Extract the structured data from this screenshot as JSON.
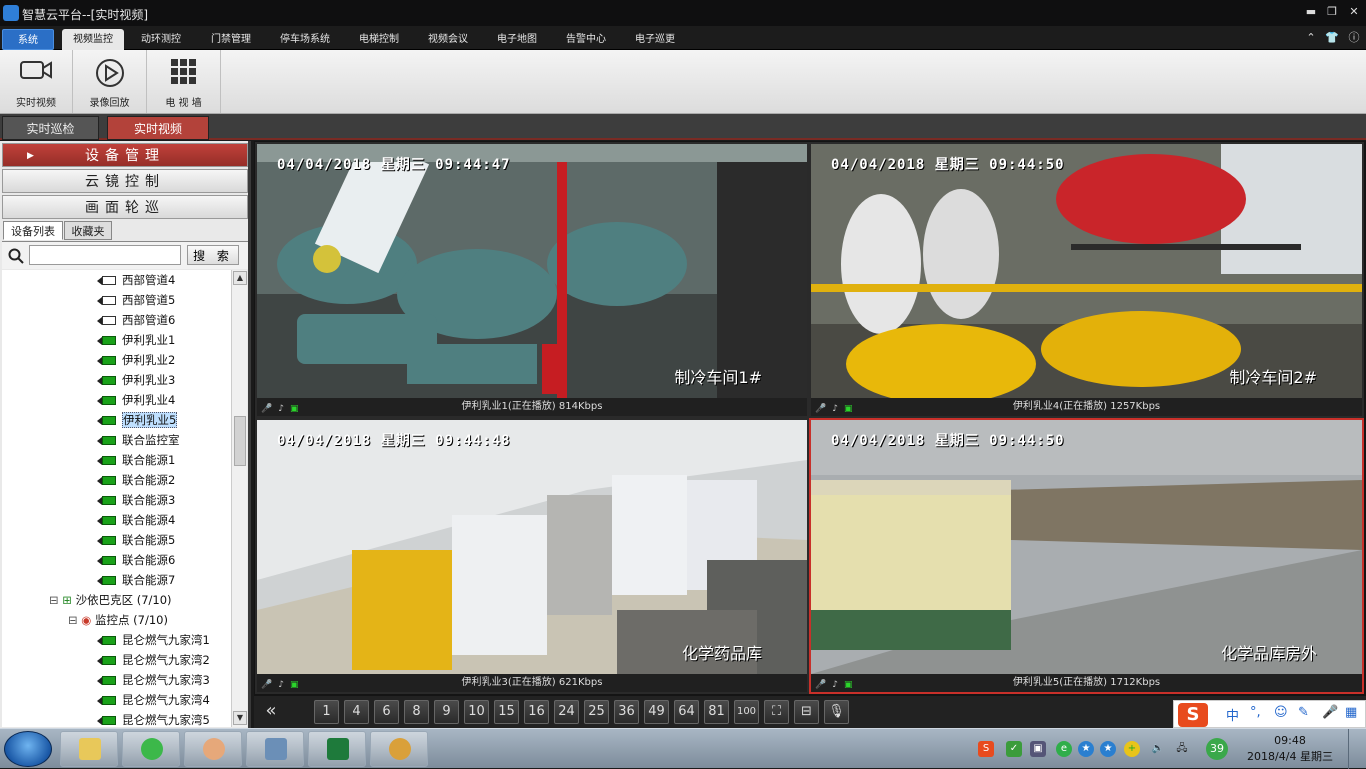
{
  "window": {
    "title": "智慧云平台--[实时视频]"
  },
  "menu": {
    "items": [
      "系统",
      "视频监控",
      "动环测控",
      "门禁管理",
      "停车场系统",
      "电梯控制",
      "视频会议",
      "电子地图",
      "告警中心",
      "电子巡更"
    ]
  },
  "ribbon": {
    "buttons": [
      "实时视频",
      "录像回放",
      "电 视 墙"
    ]
  },
  "subtabs": [
    "实时巡检",
    "实时视频"
  ],
  "left": {
    "accordion": [
      "设备管理",
      "云镜控制",
      "画面轮巡"
    ],
    "tabs": [
      "设备列表",
      "收藏夹"
    ],
    "search_button": "搜 索",
    "search_value": "",
    "tree": [
      {
        "label": "西部管道4",
        "state": "off"
      },
      {
        "label": "西部管道5",
        "state": "off"
      },
      {
        "label": "西部管道6",
        "state": "off"
      },
      {
        "label": "伊利乳业1",
        "state": "on"
      },
      {
        "label": "伊利乳业2",
        "state": "on"
      },
      {
        "label": "伊利乳业3",
        "state": "on"
      },
      {
        "label": "伊利乳业4",
        "state": "on"
      },
      {
        "label": "伊利乳业5",
        "state": "on",
        "selected": true
      },
      {
        "label": "联合监控室",
        "state": "on"
      },
      {
        "label": "联合能源1",
        "state": "on"
      },
      {
        "label": "联合能源2",
        "state": "on"
      },
      {
        "label": "联合能源3",
        "state": "on"
      },
      {
        "label": "联合能源4",
        "state": "on"
      },
      {
        "label": "联合能源5",
        "state": "on"
      },
      {
        "label": "联合能源6",
        "state": "on"
      },
      {
        "label": "联合能源7",
        "state": "on"
      },
      {
        "label": "沙依巴克区 (7/10)",
        "state": "group"
      },
      {
        "label": "监控点 (7/10)",
        "state": "subgroup"
      },
      {
        "label": "昆仑燃气九家湾1",
        "state": "on"
      },
      {
        "label": "昆仑燃气九家湾2",
        "state": "on"
      },
      {
        "label": "昆仑燃气九家湾3",
        "state": "on"
      },
      {
        "label": "昆仑燃气九家湾4",
        "state": "on"
      },
      {
        "label": "昆仑燃气九家湾5",
        "state": "on"
      }
    ]
  },
  "panes": [
    {
      "timestamp": "04/04/2018  星期三  09:44:47",
      "location": "制冷车间1#",
      "status": "伊利乳业1(正在播放)",
      "bitrate": "814Kbps"
    },
    {
      "timestamp": "04/04/2018  星期三  09:44:50",
      "location": "制冷车间2#",
      "status": "伊利乳业4(正在播放)",
      "bitrate": "1257Kbps"
    },
    {
      "timestamp": "04/04/2018  星期三  09:44:48",
      "location": "化学药品库",
      "status": "伊利乳业3(正在播放)",
      "bitrate": "621Kbps"
    },
    {
      "timestamp": "04/04/2018  星期三  09:44:50",
      "location": "化学品库房外",
      "status": "伊利乳业5(正在播放)",
      "bitrate": "1712Kbps"
    }
  ],
  "layout_buttons": [
    "1",
    "4",
    "6",
    "8",
    "9",
    "10",
    "15",
    "16",
    "24",
    "25",
    "36",
    "49",
    "64",
    "81",
    "100"
  ],
  "ime": {
    "icons": [
      "中",
      "°,",
      "☺",
      "✎",
      "🎤",
      "▦"
    ]
  },
  "taskbar": {
    "badge": "39",
    "time": "09:48",
    "date": "2018/4/4 星期三"
  },
  "colors": {
    "accent_red": "#b3423a",
    "selected_border": "#c8302a",
    "online_green": "#1aa11a",
    "menu_blue": "#2b6fc6"
  }
}
